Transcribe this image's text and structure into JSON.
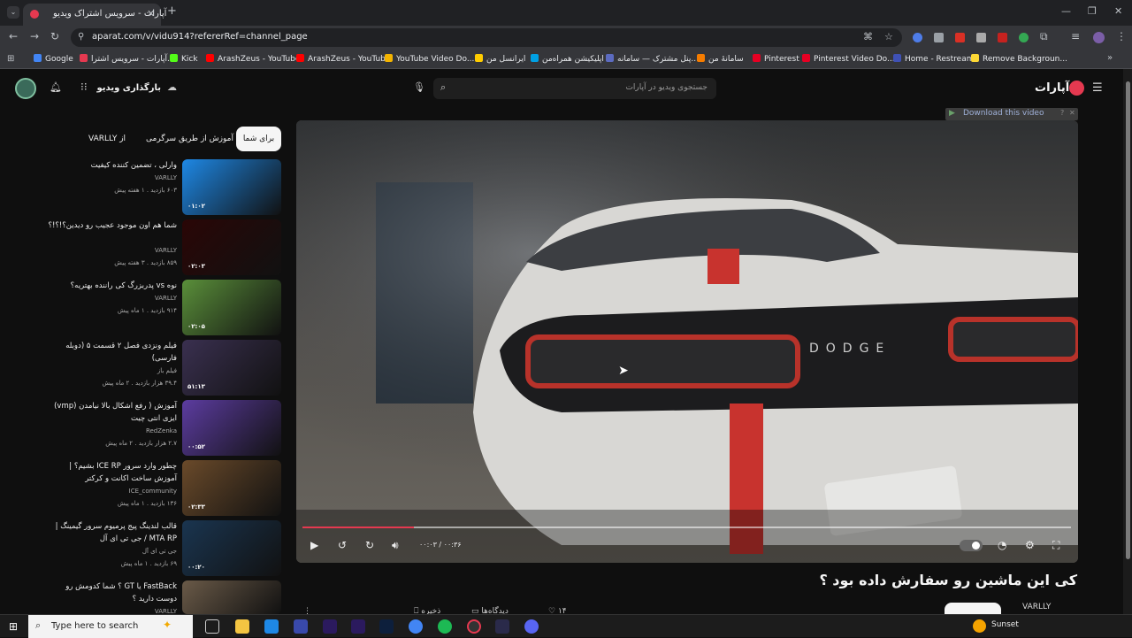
{
  "browser": {
    "tab_title": "آپارات - سرویس اشتراک ویدیو",
    "url": "aparat.com/v/vidu914?refererRef=channel_page",
    "bookmarks": [
      {
        "label": "Google",
        "color": "#4285f4"
      },
      {
        "label": "آپارات - سرویس اشترا...",
        "color": "#e53950"
      },
      {
        "label": "Kick",
        "color": "#53fc18"
      },
      {
        "label": "ArashZeus - YouTube",
        "color": "#ff0000"
      },
      {
        "label": "ArashZeus - YouTube",
        "color": "#ff0000"
      },
      {
        "label": "YouTube Video Do...",
        "color": "#f4b400"
      },
      {
        "label": "ایرانسل من",
        "color": "#ffcc00"
      },
      {
        "label": "اپلیکیشن همراه‌من",
        "color": "#00a0e3"
      },
      {
        "label": "پنل مشترک — سامانه...",
        "color": "#5c6bc0"
      },
      {
        "label": "سامانۀ من",
        "color": "#f57c00"
      },
      {
        "label": "Pinterest",
        "color": "#e60023"
      },
      {
        "label": "Pinterest Video Do...",
        "color": "#e60023"
      },
      {
        "label": "Home - Restream",
        "color": "#3f51b5"
      },
      {
        "label": "Remove Backgroun...",
        "color": "#fdd835"
      }
    ]
  },
  "site": {
    "logo": "آپارات",
    "search_placeholder": "جستجوی ویدیو در آپارات",
    "upload_label": "بارگذاری ویدیو"
  },
  "sidebar": {
    "chips": [
      {
        "label": "برای شما"
      },
      {
        "label": "آموزش از طریق سرگرمی"
      },
      {
        "label": "از VARLLY"
      }
    ],
    "videos": [
      {
        "title": "وارلی ، تضمین کننده کیفیت",
        "channel": "VARLLY",
        "meta": "۶۰۳ بازدید . ۱ هفته پیش",
        "duration": "۰۱:۰۲",
        "color": "#1e88e5"
      },
      {
        "title": "شما هم اون موجود عجیب رو دیدین؟!؟!؟",
        "channel": "VARLLY",
        "meta": "۸۵۹ بازدید . ۳ هفته پیش",
        "duration": "۰۲:۰۳",
        "color": "#2a0606"
      },
      {
        "title": "نوه vs پدربزرگ کی راننده بهتریه؟",
        "channel": "VARLLY",
        "meta": "۹۱۴ بازدید . ۱ ماه پیش",
        "duration": "۰۲:۰۵",
        "color": "#5a8f3a"
      },
      {
        "title": "فیلم ونزدی فصل ۲ قسمت ۵ (دوبله فارسی)",
        "channel": "فیلم باز",
        "meta": "۳۹.۴ هزار بازدید . ۲ ماه پیش",
        "duration": "۵۱:۱۳",
        "color": "#3a3050"
      },
      {
        "title": "آموزش ( رفع اشکال بالا نیامدن (vmp) ایزی انتی چیت",
        "channel": "RedZenka",
        "meta": "۲.۷ هزار بازدید . ۲ ماه پیش",
        "duration": "۰۰:۵۲",
        "color": "#5c3ca0"
      },
      {
        "title": "چطور وارد سرور ICE RP بشیم؟ | آموزش ساخت اکانت و کرکتر",
        "channel": "ICE_community",
        "meta": "۱۳۶ بازدید . ۱ ماه پیش",
        "duration": "۰۲:۳۳",
        "color": "#6a4a2a"
      },
      {
        "title": "قالب لندینگ پیج پرمیوم سرور گیمینگ | MTA RP / جی تی ای آل",
        "channel": "جی تی ای آل",
        "meta": "۶۹ بازدید . ۱ ماه پیش",
        "duration": "۰۰:۲۰",
        "color": "#1a3550"
      },
      {
        "title": "FastBack یا GT ؟ شما کدومش رو دوست دارید ؟",
        "channel": "VARLLY",
        "meta": "",
        "duration": "",
        "color": "#6a5a48"
      }
    ]
  },
  "player": {
    "download_banner": "Download this video",
    "time": "۰۰:۰۳ / ۰۰:۳۶",
    "progress": 0.145
  },
  "video": {
    "title": "کی این ماشین رو سفارش داده بود ؟",
    "channel": "VARLLY",
    "likes": "۱۴",
    "save_label": "ذخیره",
    "playlist_label": "دیدگاه‌ها"
  },
  "taskbar": {
    "search_placeholder": "Type here to search",
    "weather": "Sunset"
  }
}
